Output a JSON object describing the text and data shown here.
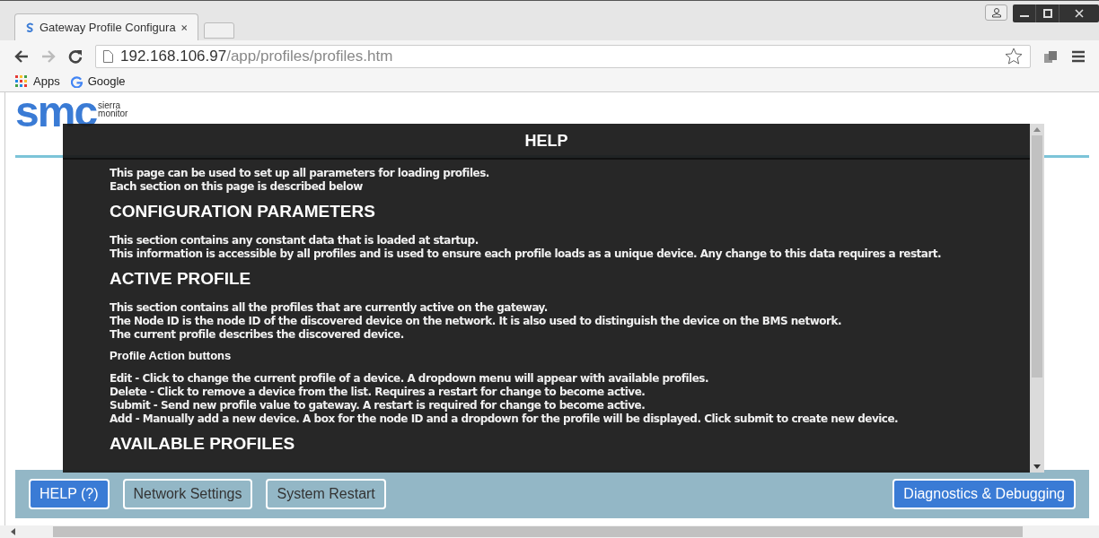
{
  "browser": {
    "tab_title": "Gateway Profile Configura",
    "url_host": "192.168.106.97",
    "url_path": "/app/profiles/profiles.htm",
    "bookmarks": [
      {
        "label": "Apps",
        "kind": "apps"
      },
      {
        "label": "Google",
        "kind": "google"
      }
    ]
  },
  "logo": {
    "mark": "smc",
    "line1": "sierra",
    "line2": "monitor"
  },
  "buttons": [
    {
      "label": "HELP (?)",
      "selected": true
    },
    {
      "label": "Network Settings",
      "selected": false
    },
    {
      "label": "System Restart",
      "selected": false
    }
  ],
  "right_button": {
    "label": "Diagnostics & Debugging",
    "selected": true
  },
  "help": {
    "title": "HELP",
    "blocks": [
      {
        "kind": "text",
        "lines": [
          "This page can be used to set up all parameters for loading profiles.",
          "Each section on this page is described below"
        ]
      },
      {
        "kind": "heading",
        "text": "CONFIGURATION PARAMETERS"
      },
      {
        "kind": "text",
        "lines": [
          "This section contains any constant data that is loaded at startup.",
          "This information is accessible by all profiles and is used to ensure each profile loads as a unique device. Any change to this data requires a restart."
        ]
      },
      {
        "kind": "heading",
        "text": "ACTIVE PROFILE"
      },
      {
        "kind": "text",
        "lines": [
          "This section contains all the profiles that are currently active on the gateway.",
          "The Node ID is the node ID of the discovered device on the network. It is also used to distinguish the device on the BMS network.",
          "The current profile describes the discovered device."
        ]
      },
      {
        "kind": "subheading",
        "text": "Profile Action buttons"
      },
      {
        "kind": "text",
        "lines": [
          "Edit - Click to change the current profile of a device. A dropdown menu will appear with available profiles.",
          "Delete - Click to remove a device from the list. Requires a restart for change to become active.",
          "Submit - Send new profile value to gateway. A restart is required for change to become active.",
          "Add - Manually add a new device. A box for the node ID and a dropdown for the profile will be displayed. Click submit to create new device."
        ]
      },
      {
        "kind": "heading",
        "text": "AVAILABLE PROFILES"
      }
    ]
  }
}
